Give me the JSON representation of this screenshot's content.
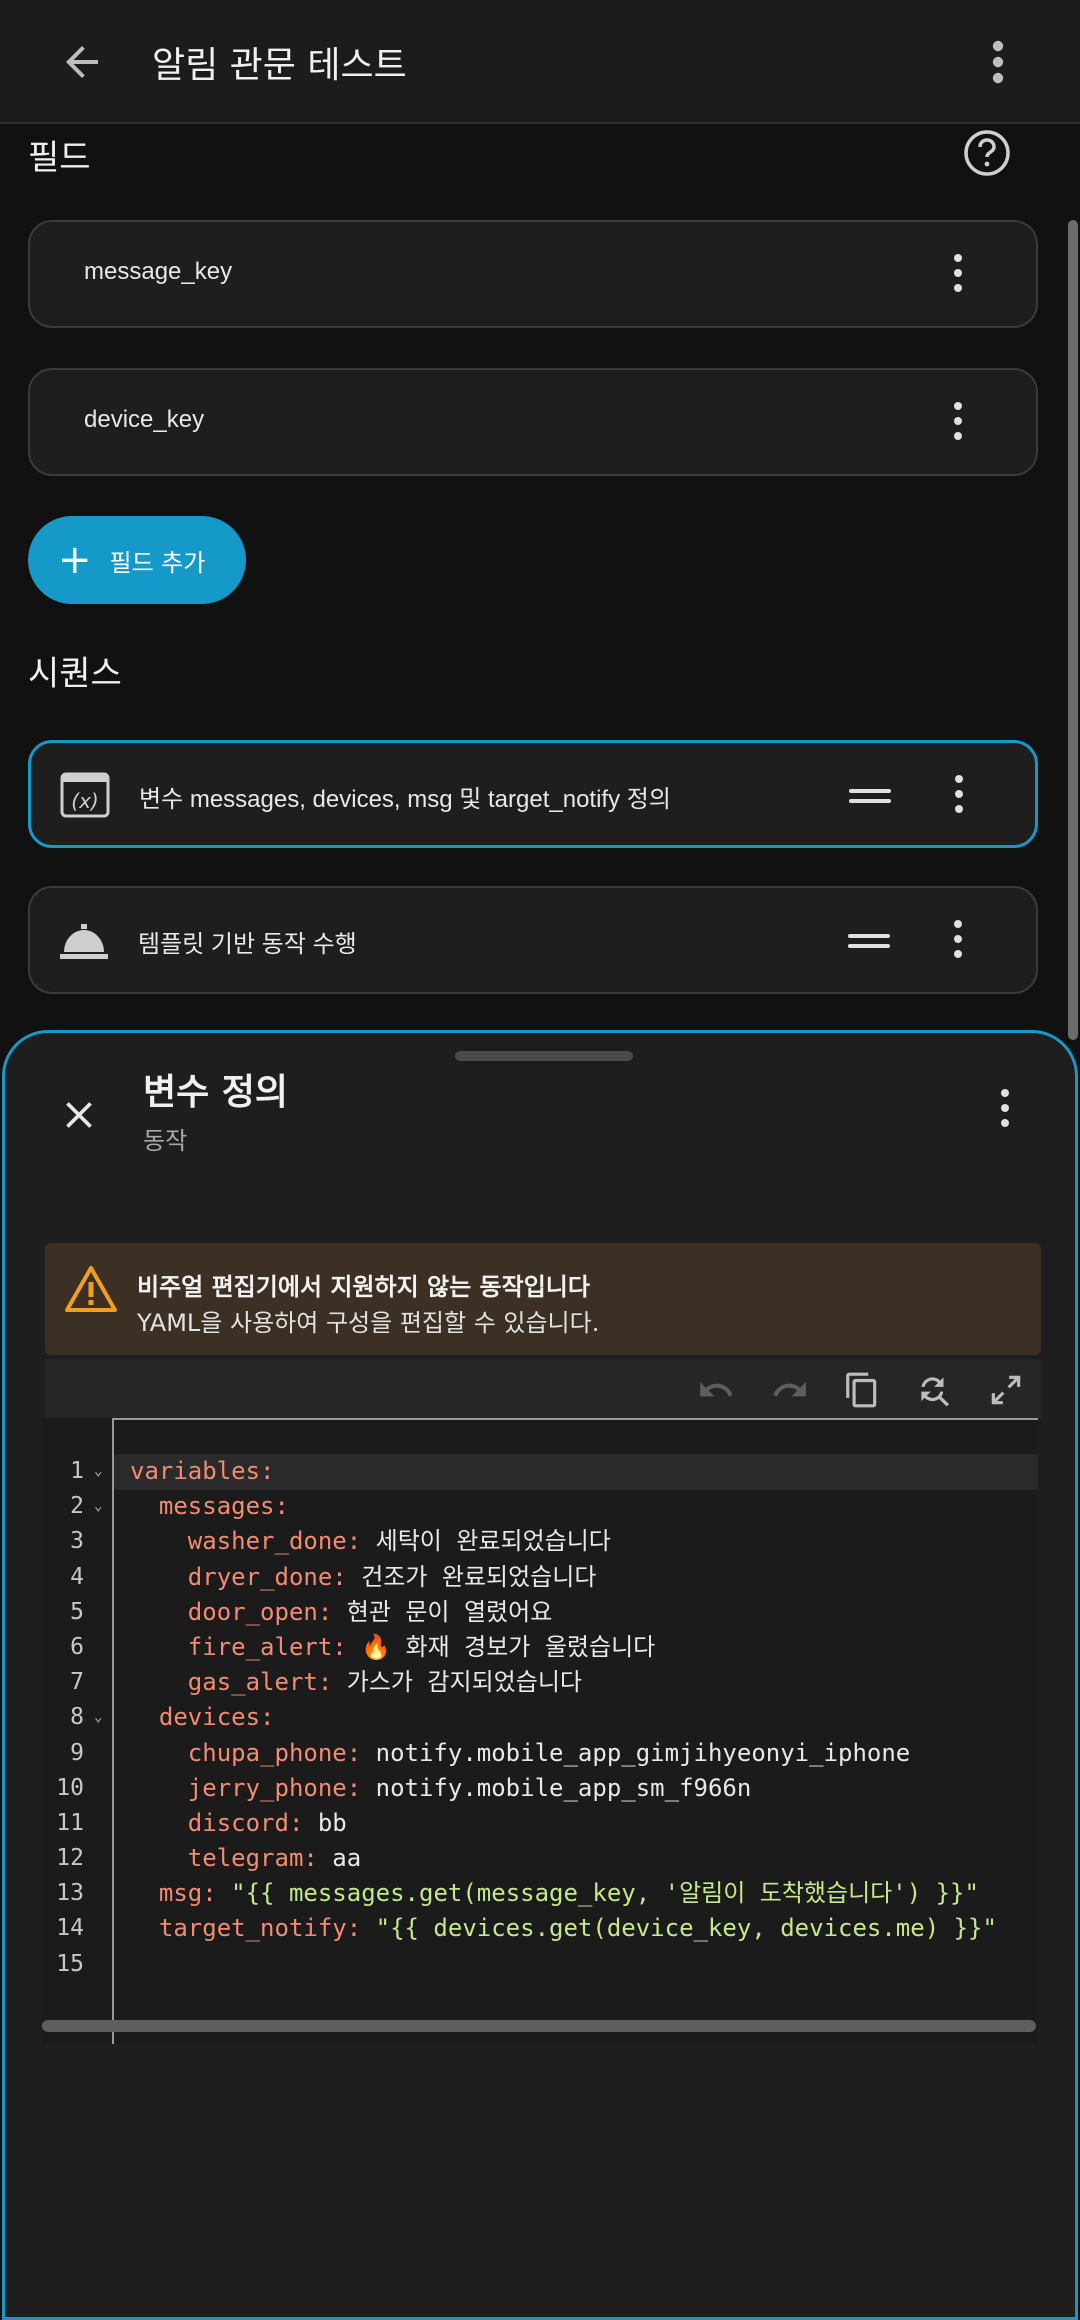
{
  "header": {
    "title": "알림 관문 테스트"
  },
  "fields": {
    "section_title": "필드",
    "items": [
      "message_key",
      "device_key"
    ],
    "add_label": "필드 추가"
  },
  "sequence": {
    "section_title": "시퀀스",
    "items": [
      "변수 messages, devices, msg 및 target_notify 정의",
      "템플릿 기반 동작 수행"
    ]
  },
  "sheet": {
    "title": "변수 정의",
    "subtitle": "동작",
    "warning_title": "비주얼 편집기에서 지원하지 않는 동작입니다",
    "warning_body": "YAML을 사용하여 구성을 편집할 수 있습니다."
  },
  "code": {
    "line_numbers": [
      "1",
      "2",
      "3",
      "4",
      "5",
      "6",
      "7",
      "8",
      "9",
      "10",
      "11",
      "12",
      "13",
      "14",
      "15"
    ],
    "lines": [
      {
        "key": "variables:",
        "val": ""
      },
      {
        "key": "  messages:",
        "val": ""
      },
      {
        "key": "    washer_done:",
        "val": " 세탁이 완료되었습니다"
      },
      {
        "key": "    dryer_done:",
        "val": " 건조가 완료되었습니다"
      },
      {
        "key": "    door_open:",
        "val": " 현관 문이 열렸어요"
      },
      {
        "key": "    fire_alert:",
        "val": " 🔥 화재 경보가 울렸습니다"
      },
      {
        "key": "    gas_alert:",
        "val": " 가스가 감지되었습니다"
      },
      {
        "key": "  devices:",
        "val": ""
      },
      {
        "key": "    chupa_phone:",
        "val": " notify.mobile_app_gimjihyeonyi_iphone"
      },
      {
        "key": "    jerry_phone:",
        "val": " notify.mobile_app_sm_f966n"
      },
      {
        "key": "    discord:",
        "val": " bb"
      },
      {
        "key": "    telegram:",
        "val": " aa"
      },
      {
        "key": "  msg:",
        "str": " \"{{ messages.get(message_key, '알림이 도착했습니다') }}\""
      },
      {
        "key": "  target_notify:",
        "str": " \"{{ devices.get(device_key, devices.me) }}\""
      },
      {
        "key": "",
        "val": ""
      }
    ]
  },
  "colors": {
    "accent": "#1599c9",
    "key": "#f28b72",
    "string": "#c3e88d"
  }
}
